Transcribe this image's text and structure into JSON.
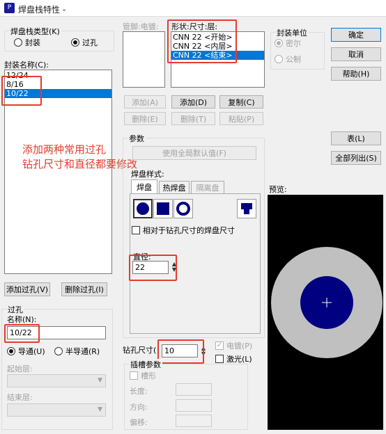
{
  "window": {
    "title": "焊盘栈特性 -",
    "icon_text": "P"
  },
  "stack_type": {
    "label": "焊盘栈类型(K)",
    "options": [
      "封装",
      "过孔"
    ],
    "selected": 1
  },
  "pkg_list": {
    "label": "封装名称(C):",
    "items": [
      "12/24",
      "8/16",
      "10/22"
    ],
    "selected": 2
  },
  "pin_label": "管脚:电镀:",
  "shape_list": {
    "label": "形状:尺寸:层:",
    "items": [
      "CNN 22 <开始>",
      "CNN 22 <内层>",
      "CNN 22 <结束>"
    ],
    "selected": 2
  },
  "pkg_unit": {
    "label": "封装单位",
    "options": [
      "密尔",
      "公制"
    ],
    "selected": 0
  },
  "buttons": {
    "ok": "确定",
    "cancel": "取消",
    "help": "帮助(H)",
    "add_a": "添加(A)",
    "delete_e": "删除(E)",
    "add_d": "添加(D)",
    "copy_c": "复制(C)",
    "delete_t": "删除(T)",
    "paste_p": "粘贴(P)",
    "table": "表(L)",
    "list_all": "全部列出(S)",
    "add_via": "添加过孔(V)",
    "delete_via": "删除过孔(I)",
    "use_global": "使用全局默认值(F)"
  },
  "annotation": {
    "line1": "添加两种常用过孔",
    "line2": "钻孔尺寸和直径都要修改"
  },
  "params": {
    "label": "参数",
    "pad_style": "焊盘样式:",
    "tabs": [
      "焊盘",
      "热焊盘",
      "隔离盘"
    ],
    "relative_check": "相对于钻孔尺寸的焊盘尺寸",
    "diameter_label": "直径:",
    "diameter_value": "22"
  },
  "preview": {
    "label": "预览:",
    "pad_color": "#000080",
    "ring_color": "#c0c0c0"
  },
  "via": {
    "group_label": "过孔",
    "name_label": "名称(N):",
    "name_value": "10/22",
    "mode_options": [
      "导通(U)",
      "半导通(R)"
    ],
    "mode_selected": 0,
    "start_layer": "起始层:",
    "end_layer": "结束层:"
  },
  "drill": {
    "label": "钻孔尺寸(",
    "value": "10",
    "plated": "电镀(P)",
    "laser": "激光(L)"
  },
  "slot": {
    "label": "插槽参数",
    "slot_check": "槽形",
    "length": "长度:",
    "direction": "方向:",
    "offset": "偏移:"
  }
}
